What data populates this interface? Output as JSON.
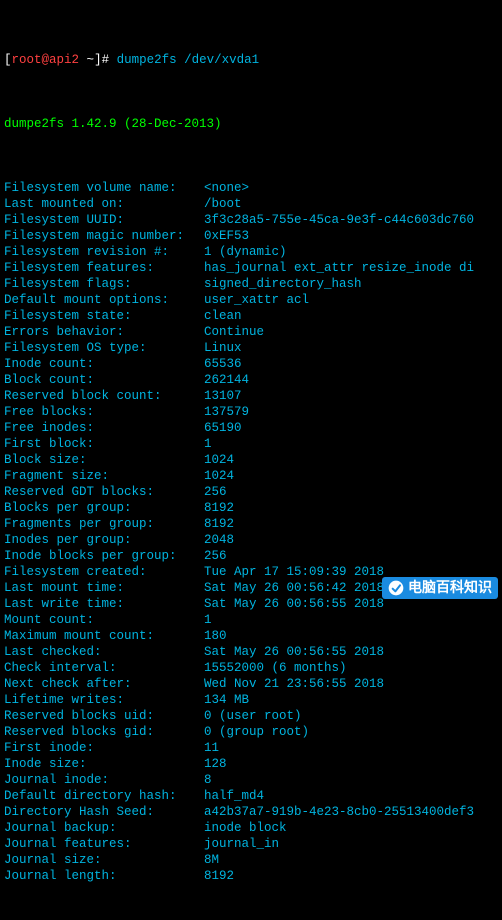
{
  "prompt": {
    "user_host": "root@api2",
    "path": "~",
    "symbol": "#",
    "command": "dumpe2fs /dev/xvda1"
  },
  "banner": "dumpe2fs 1.42.9 (28-Dec-2013)",
  "rows": [
    {
      "label": "Filesystem volume name:",
      "value": "<none>"
    },
    {
      "label": "Last mounted on:",
      "value": "/boot"
    },
    {
      "label": "Filesystem UUID:",
      "value": "3f3c28a5-755e-45ca-9e3f-c44c603dc760"
    },
    {
      "label": "Filesystem magic number:",
      "value": "0xEF53"
    },
    {
      "label": "Filesystem revision #:",
      "value": "1 (dynamic)"
    },
    {
      "label": "Filesystem features:",
      "value": "has_journal ext_attr resize_inode di"
    },
    {
      "label": "Filesystem flags:",
      "value": "signed_directory_hash"
    },
    {
      "label": "Default mount options:",
      "value": "user_xattr acl"
    },
    {
      "label": "Filesystem state:",
      "value": "clean"
    },
    {
      "label": "Errors behavior:",
      "value": "Continue"
    },
    {
      "label": "Filesystem OS type:",
      "value": "Linux"
    },
    {
      "label": "Inode count:",
      "value": "65536"
    },
    {
      "label": "Block count:",
      "value": "262144"
    },
    {
      "label": "Reserved block count:",
      "value": "13107"
    },
    {
      "label": "Free blocks:",
      "value": "137579"
    },
    {
      "label": "Free inodes:",
      "value": "65190"
    },
    {
      "label": "First block:",
      "value": "1"
    },
    {
      "label": "Block size:",
      "value": "1024"
    },
    {
      "label": "Fragment size:",
      "value": "1024"
    },
    {
      "label": "Reserved GDT blocks:",
      "value": "256"
    },
    {
      "label": "Blocks per group:",
      "value": "8192"
    },
    {
      "label": "Fragments per group:",
      "value": "8192"
    },
    {
      "label": "Inodes per group:",
      "value": "2048"
    },
    {
      "label": "Inode blocks per group:",
      "value": "256"
    },
    {
      "label": "Filesystem created:",
      "value": "Tue Apr 17 15:09:39 2018"
    },
    {
      "label": "Last mount time:",
      "value": "Sat May 26 00:56:42 2018"
    },
    {
      "label": "Last write time:",
      "value": "Sat May 26 00:56:55 2018"
    },
    {
      "label": "Mount count:",
      "value": "1"
    },
    {
      "label": "Maximum mount count:",
      "value": "180"
    },
    {
      "label": "Last checked:",
      "value": "Sat May 26 00:56:55 2018"
    },
    {
      "label": "Check interval:",
      "value": "15552000 (6 months)"
    },
    {
      "label": "Next check after:",
      "value": "Wed Nov 21 23:56:55 2018"
    },
    {
      "label": "Lifetime writes:",
      "value": "134 MB"
    },
    {
      "label": "Reserved blocks uid:",
      "value": "0 (user root)"
    },
    {
      "label": "Reserved blocks gid:",
      "value": "0 (group root)"
    },
    {
      "label": "First inode:",
      "value": "11"
    },
    {
      "label": "Inode size:",
      "value": "128"
    },
    {
      "label": "Journal inode:",
      "value": "8"
    },
    {
      "label": "Default directory hash:",
      "value": "half_md4"
    },
    {
      "label": "Directory Hash Seed:",
      "value": "a42b37a7-919b-4e23-8cb0-25513400def3"
    },
    {
      "label": "Journal backup:",
      "value": "inode block"
    },
    {
      "label": "Journal features:",
      "value": "journal_in"
    },
    {
      "label": "Journal size:",
      "value": "8M"
    },
    {
      "label": "Journal length:",
      "value": "8192"
    }
  ],
  "watermark": "电脑百科知识"
}
